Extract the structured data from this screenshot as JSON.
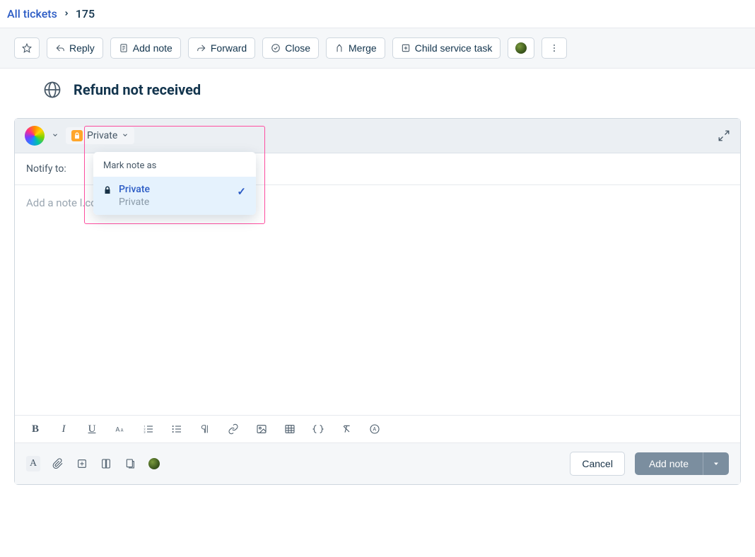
{
  "breadcrumb": {
    "root": "All tickets",
    "current": "175"
  },
  "toolbar": {
    "reply": "Reply",
    "add_note": "Add note",
    "forward": "Forward",
    "close": "Close",
    "merge": "Merge",
    "child_task": "Child service task"
  },
  "ticket": {
    "title": "Refund not received"
  },
  "compose": {
    "visibility_label": "Private",
    "notify_label": "Notify to:",
    "editor_placeholder": "Add a note                                         l.com to invite to Freshdesk",
    "dropdown": {
      "header": "Mark note as",
      "option_title": "Private",
      "option_sub": "Private"
    }
  },
  "footer": {
    "cancel": "Cancel",
    "submit": "Add note"
  }
}
